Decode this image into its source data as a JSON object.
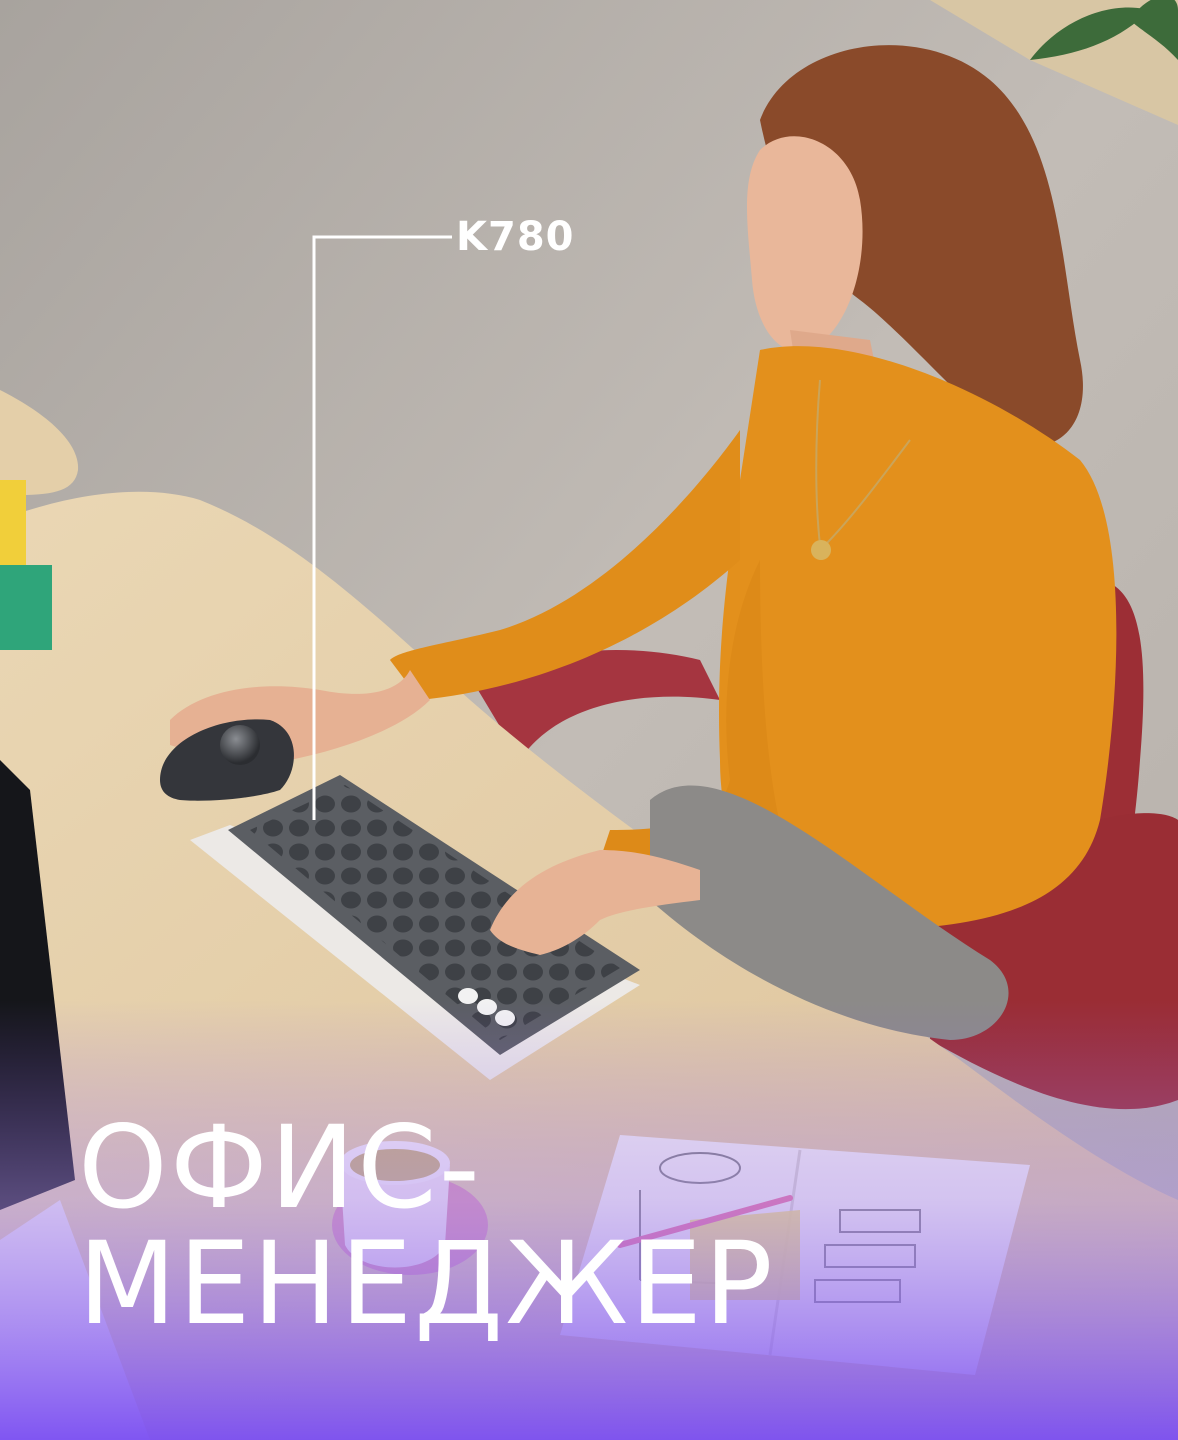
{
  "callout": {
    "label": "K780"
  },
  "headline": {
    "line1": "ОФИС-",
    "line2": "МЕНЕДЖЕР"
  },
  "colors": {
    "accent_purple": "#8d5ff5",
    "sweater": "#e3901c",
    "chair": "#9c2e35",
    "desk": "#e6d2ae",
    "floor": "#bdb7b2"
  }
}
